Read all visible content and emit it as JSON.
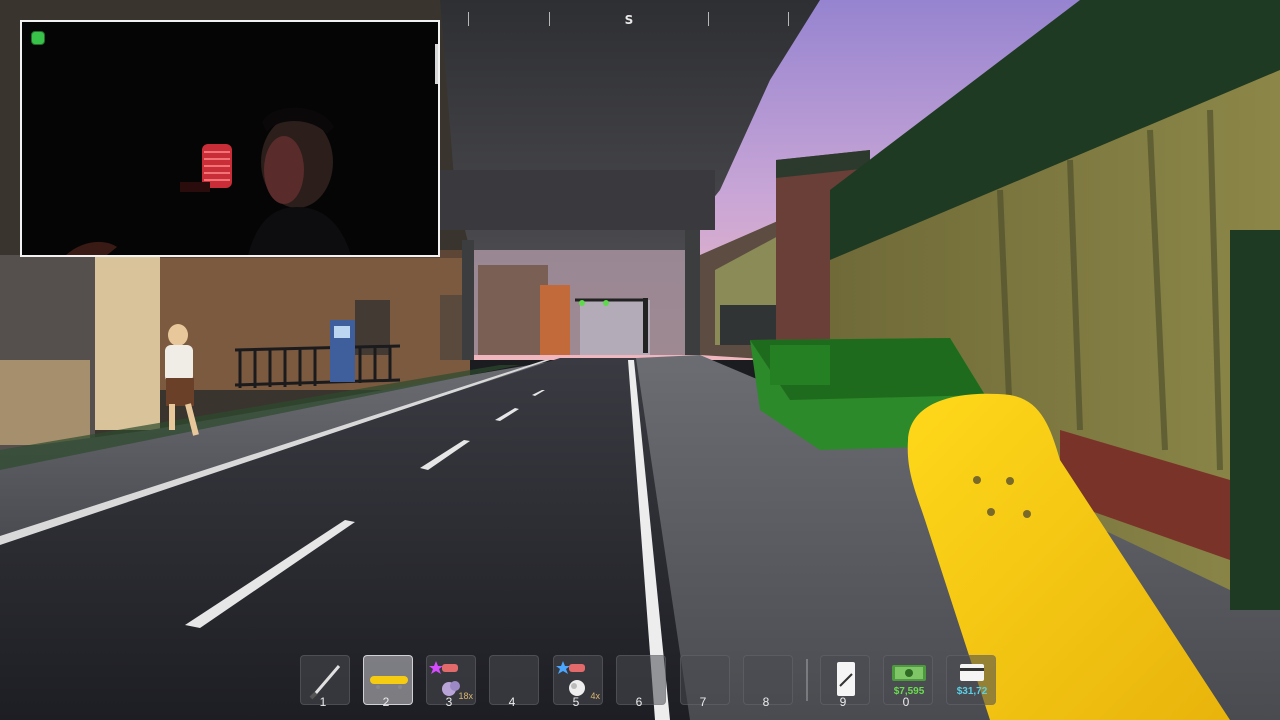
{
  "compass": {
    "heading": "S"
  },
  "webcam": {
    "recording_color": "#39c24a"
  },
  "hotbar": {
    "slots": [
      {
        "number": "1",
        "item": "knife-icon"
      },
      {
        "number": "2",
        "item": "skateboard-icon",
        "selected": true
      },
      {
        "number": "3",
        "item": "weed-bag-icon",
        "quantity": "18x",
        "star_color": "#d64bff"
      },
      {
        "number": "4",
        "item": ""
      },
      {
        "number": "5",
        "item": "powder-bag-icon",
        "quantity": "4x",
        "star_color": "#4aa6ff"
      },
      {
        "number": "6",
        "item": ""
      },
      {
        "number": "7",
        "item": ""
      },
      {
        "number": "8",
        "item": ""
      },
      {
        "number": "9",
        "item": "phone-card-icon"
      },
      {
        "number": "0",
        "item": "cash-icon",
        "value": "$7,595",
        "value_color": "#6bdc4f"
      },
      {
        "number": "",
        "item": "bank-card-icon",
        "value": "$31,72",
        "value_color": "#5ad0e8"
      }
    ]
  },
  "colors": {
    "skateboard": "#f5cc12",
    "dumpster": "#2f8a2c",
    "sky_top": "#9e8fd6",
    "sky_bottom": "#e9b4c6"
  }
}
